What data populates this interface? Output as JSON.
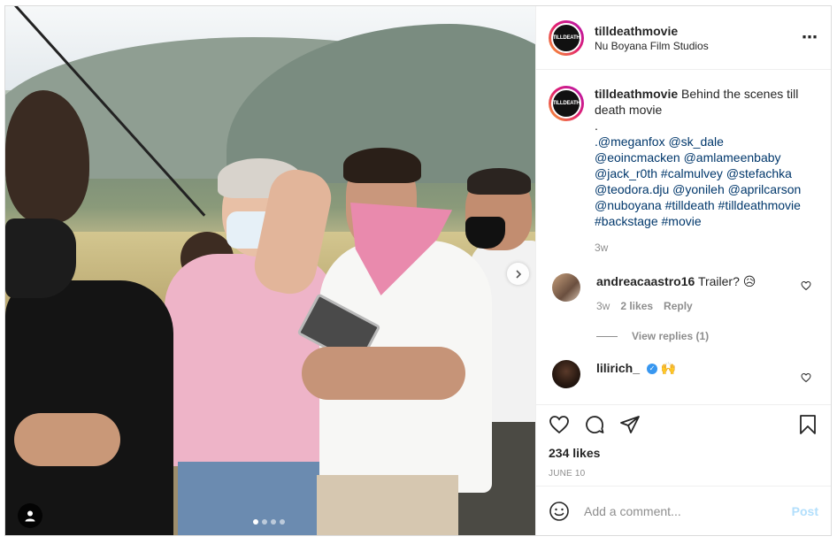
{
  "post": {
    "username": "tilldeathmovie",
    "location": "Nu Boyana Film Studios",
    "avatar_text": "TILLDEATH",
    "more_icon": "⋯"
  },
  "caption": {
    "username": "tilldeathmovie",
    "text": "Behind the scenes till death movie",
    "dot": ".",
    "mentions": ".@meganfox @sk_dale @eoincmacken @amlameenbaby @jack_r0th #calmulvey @stefachka @teodora.dju @yonileh  @aprilcarson @nuboyana #tilldeath #tilldeathmovie #backstage #movie",
    "time": "3w"
  },
  "comments": [
    {
      "username": "andreacaastro16",
      "text": "Trailer? 😥",
      "time": "3w",
      "likes": "2 likes",
      "reply": "Reply"
    },
    {
      "username": "lilirich_",
      "verified": "✓",
      "text": "🙌"
    }
  ],
  "view_replies": "View replies (1)",
  "likes": "234 likes",
  "date": "JUNE 10",
  "add_comment": {
    "placeholder": "Add a comment...",
    "post_label": "Post"
  },
  "carousel": {
    "dot_count": 4,
    "active_index": 0
  },
  "colors": {
    "link": "#00376b",
    "post_disabled": "#b2dffc",
    "muted": "#8e8e8e",
    "verified": "#3897f0"
  }
}
